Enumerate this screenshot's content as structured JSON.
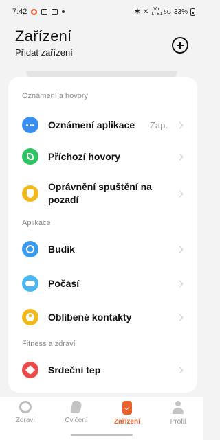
{
  "status_bar": {
    "time": "7:42",
    "network": "Vo LTE1",
    "network_secondary": "5G",
    "battery": "33%"
  },
  "header": {
    "title": "Zařízení",
    "subtitle": "Přidat zařízení"
  },
  "sections": [
    {
      "title": "Oznámení a hovory",
      "items": [
        {
          "label": "Oznámení aplikace",
          "value": "Zap.",
          "icon": "chat-bubble-icon",
          "color": "#3a8ef0"
        },
        {
          "label": "Příchozí hovory",
          "value": "",
          "icon": "phone-icon",
          "color": "#2fc463"
        },
        {
          "label": "Oprávnění spuštění na pozadí",
          "value": "",
          "icon": "shield-icon",
          "color": "#f2b91d"
        }
      ]
    },
    {
      "title": "Aplikace",
      "items": [
        {
          "label": "Budík",
          "value": "",
          "icon": "clock-icon",
          "color": "#3a9bf0"
        },
        {
          "label": "Počasí",
          "value": "",
          "icon": "weather-icon",
          "color": "#48b6f5"
        },
        {
          "label": "Oblíbené kontakty",
          "value": "",
          "icon": "contact-icon",
          "color": "#f2b91d"
        }
      ]
    },
    {
      "title": "Fitness a zdraví",
      "items": [
        {
          "label": "Srdeční tep",
          "value": "",
          "icon": "heart-icon",
          "color": "#ec4b4b"
        }
      ]
    }
  ],
  "bottom_nav": [
    {
      "label": "Zdraví",
      "icon": "health-ring-icon",
      "active": false
    },
    {
      "label": "Cvičení",
      "icon": "shoe-icon",
      "active": false
    },
    {
      "label": "Zařízení",
      "icon": "watch-icon",
      "active": true
    },
    {
      "label": "Profil",
      "icon": "profile-icon",
      "active": false
    }
  ],
  "colors": {
    "accent": "#e8632b",
    "background": "#f3f3f3",
    "card": "#ffffff"
  }
}
